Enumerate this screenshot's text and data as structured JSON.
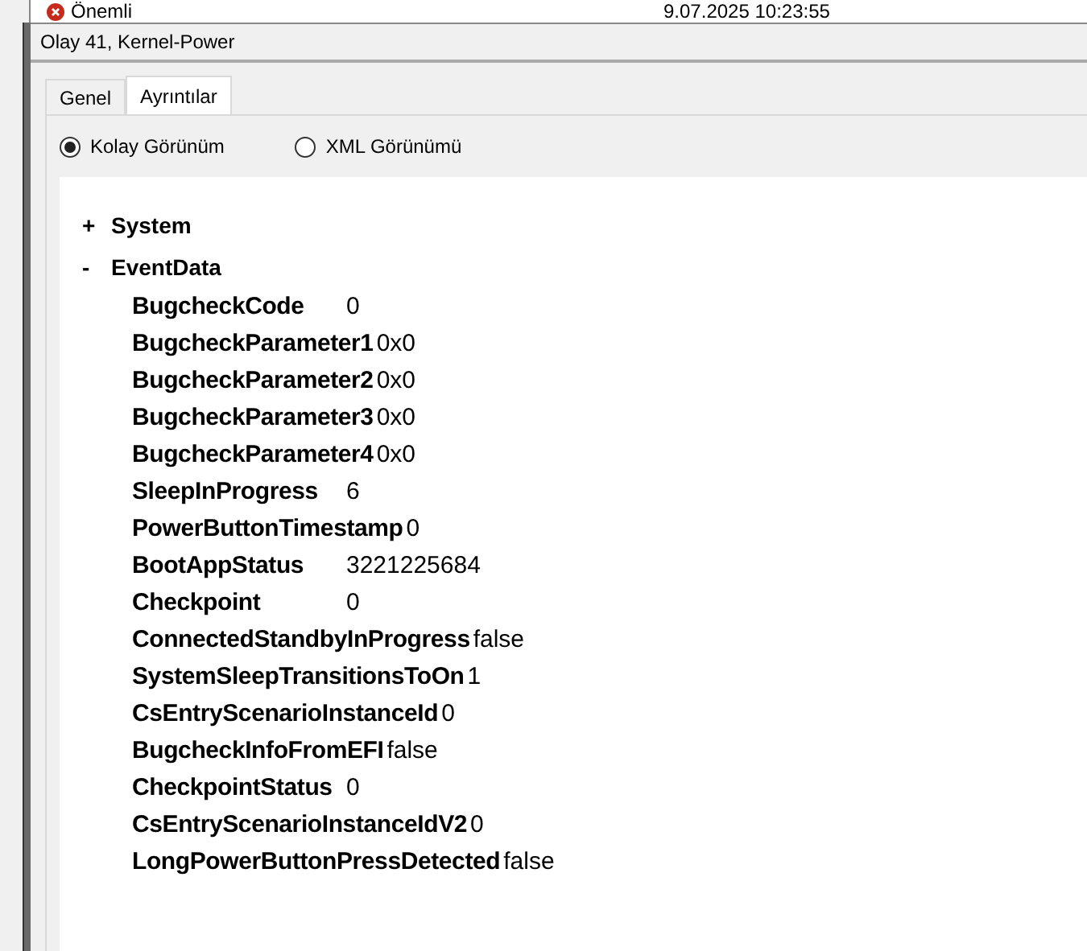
{
  "list_row": {
    "level": "Önemli",
    "date": "9.07.2025 10:23:55"
  },
  "window": {
    "title": "Olay 41, Kernel-Power"
  },
  "tabs": [
    {
      "label": "Genel",
      "selected": false
    },
    {
      "label": "Ayrıntılar",
      "selected": true
    }
  ],
  "views": [
    {
      "label": "Kolay Görünüm",
      "selected": true
    },
    {
      "label": "XML Görünümü",
      "selected": false
    }
  ],
  "tree": [
    {
      "sign": "+",
      "label": "System"
    },
    {
      "sign": "-",
      "label": "EventData",
      "children": [
        {
          "key": "BugcheckCode",
          "value": "0"
        },
        {
          "key": "BugcheckParameter1",
          "value": "0x0"
        },
        {
          "key": "BugcheckParameter2",
          "value": "0x0"
        },
        {
          "key": "BugcheckParameter3",
          "value": "0x0"
        },
        {
          "key": "BugcheckParameter4",
          "value": "0x0"
        },
        {
          "key": "SleepInProgress",
          "value": "6"
        },
        {
          "key": "PowerButtonTimestamp",
          "value": "0"
        },
        {
          "key": "BootAppStatus",
          "value": "3221225684"
        },
        {
          "key": "Checkpoint",
          "value": "0"
        },
        {
          "key": "ConnectedStandbyInProgress",
          "value": "false"
        },
        {
          "key": "SystemSleepTransitionsToOn",
          "value": "1"
        },
        {
          "key": "CsEntryScenarioInstanceId",
          "value": "0"
        },
        {
          "key": "BugcheckInfoFromEFI",
          "value": "false"
        },
        {
          "key": "CheckpointStatus",
          "value": "0"
        },
        {
          "key": "CsEntryScenarioInstanceIdV2",
          "value": "0"
        },
        {
          "key": "LongPowerButtonPressDetected",
          "value": "false"
        }
      ]
    }
  ]
}
